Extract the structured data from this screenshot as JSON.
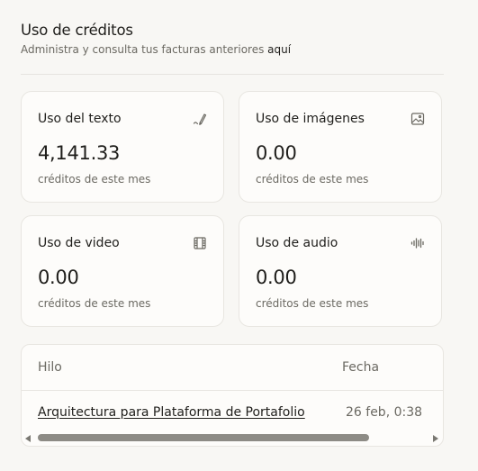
{
  "header": {
    "title": "Uso de créditos",
    "subtitle": "Administra y consulta tus facturas anteriores",
    "link": "aquí"
  },
  "cards": [
    {
      "label": "Uso del texto",
      "value": "4,141.33",
      "sublabel": "créditos de este mes",
      "icon": "pen-icon"
    },
    {
      "label": "Uso de imágenes",
      "value": "0.00",
      "sublabel": "créditos de este mes",
      "icon": "image-icon"
    },
    {
      "label": "Uso de video",
      "value": "0.00",
      "sublabel": "créditos de este mes",
      "icon": "film-icon"
    },
    {
      "label": "Uso de audio",
      "value": "0.00",
      "sublabel": "créditos de este mes",
      "icon": "waveform-icon"
    }
  ],
  "table": {
    "columns": [
      "Hilo",
      "Fecha"
    ],
    "rows": [
      {
        "hilo": "Arquitectura para Plataforma de Portafolio",
        "fecha": "26 feb, 0:38"
      }
    ]
  }
}
